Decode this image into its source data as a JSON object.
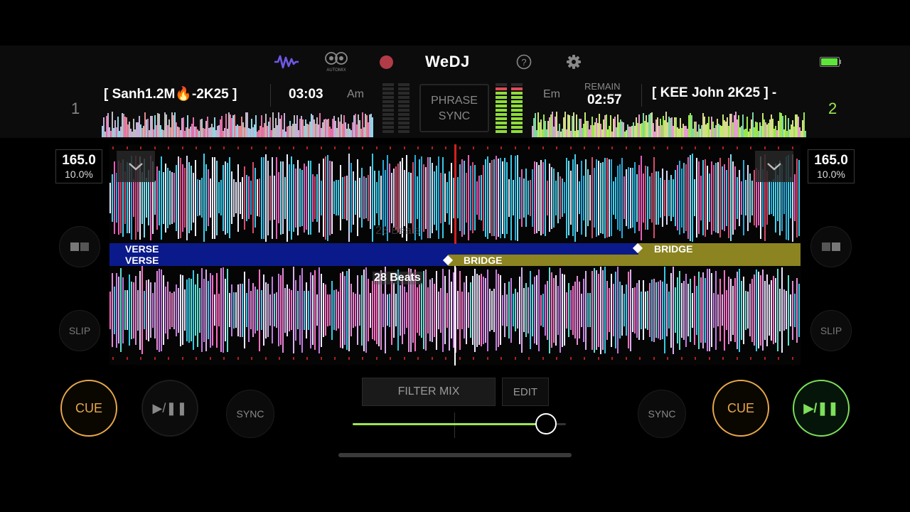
{
  "app": {
    "name": "WeDJ",
    "automix_label": "AUTOMIX"
  },
  "colors": {
    "accent_green": "#9be64f",
    "cue_orange": "#e8a84a",
    "verse_blue": "#0b1a8a",
    "bridge_olive": "#8c8420",
    "playhead_red": "#d42020"
  },
  "deck1": {
    "number": "1",
    "title": "[ Sanh1.2M🔥-2K25 ]",
    "time": "03:03",
    "key": "Am",
    "bpm": "165.0",
    "pitch": "10.0%",
    "phrases": {
      "left": "VERSE",
      "right": "BRIDGE"
    },
    "beats_label": "28 Beats",
    "cue_label": "CUE",
    "play_label": "▶/❚❚",
    "sync_label": "SYNC",
    "slip_label": "SLIP"
  },
  "deck2": {
    "number": "2",
    "title": "[ KEE  John 2K25 ] -",
    "remain_label": "REMAIN",
    "time": "02:57",
    "key": "Em",
    "bpm": "165.0",
    "pitch": "10.0%",
    "phrases": {
      "left": "VERSE",
      "right": "BRIDGE"
    },
    "beats_label": "28 Beats",
    "cue_label": "CUE",
    "play_label": "▶/❚❚",
    "sync_label": "SYNC",
    "slip_label": "SLIP"
  },
  "center": {
    "phrase_sync_line1": "PHRASE",
    "phrase_sync_line2": "SYNC",
    "filter_mix_label": "FILTER MIX",
    "edit_label": "EDIT",
    "crossfader_position": 0.95
  },
  "icons": [
    "waveform-icon",
    "automix-icon",
    "record-icon",
    "help-icon",
    "settings-icon",
    "battery-icon",
    "chevron-down-icon"
  ]
}
